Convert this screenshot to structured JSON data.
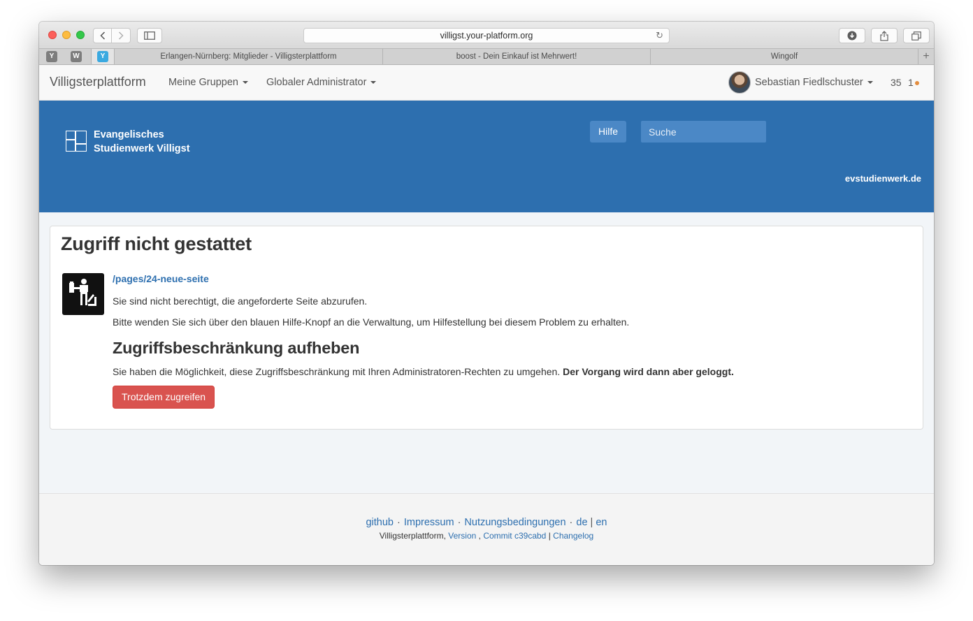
{
  "browser": {
    "url": "villigst.your-platform.org",
    "pinned_tabs": [
      {
        "letter": "Y",
        "color": "#7d7d7d"
      },
      {
        "letter": "W",
        "color": "#7d7d7d"
      },
      {
        "letter": "Y",
        "color": "#3aa9e0"
      }
    ],
    "tabs": [
      {
        "title": "Erlangen-Nürnberg: Mitglieder - Villigsterplattform"
      },
      {
        "title": "boost - Dein Einkauf ist Mehrwert!"
      },
      {
        "title": "Wingolf"
      }
    ],
    "new_tab": "+"
  },
  "navbar": {
    "brand": "Villigsterplattform",
    "menu_groups": "Meine Gruppen",
    "menu_admin": "Globaler Administrator",
    "user_name": "Sebastian Fiedlschuster",
    "counter_1": "35",
    "counter_2": "1"
  },
  "banner": {
    "org_line1": "Evangelisches",
    "org_line2": "Studienwerk Villigst",
    "help_button": "Hilfe",
    "search_placeholder": "Suche",
    "external_link": "evstudienwerk.de",
    "background_color": "#2d6faf"
  },
  "main": {
    "title": "Zugriff nicht gestattet",
    "path": "/pages/24-neue-seite",
    "message": "Sie sind nicht berechtigt, die angeforderte Seite abzurufen.",
    "help_text": "Bitte wenden Sie sich über den blauen Hilfe-Knopf an die Verwaltung, um Hilfestellung bei diesem Problem zu erhalten.",
    "override_heading": "Zugriffsbeschränkung aufheben",
    "override_text": "Sie haben die Möglichkeit, diese Zugriffsbeschränkung mit Ihren Administratoren-Rechten zu umgehen.",
    "override_text_bold": "Der Vorgang wird dann aber geloggt.",
    "override_button": "Trotzdem zugreifen",
    "button_color": "#d9534f"
  },
  "footer": {
    "links": {
      "github": "github",
      "impressum": "Impressum",
      "terms": "Nutzungsbedingungen",
      "lang_de": "de",
      "lang_en": "en"
    },
    "dot": "·",
    "pipe": "|",
    "meta": {
      "platform": "Villigsterplattform,",
      "version": "Version",
      "commit": "Commit c39cabd",
      "changelog": "Changelog"
    }
  }
}
